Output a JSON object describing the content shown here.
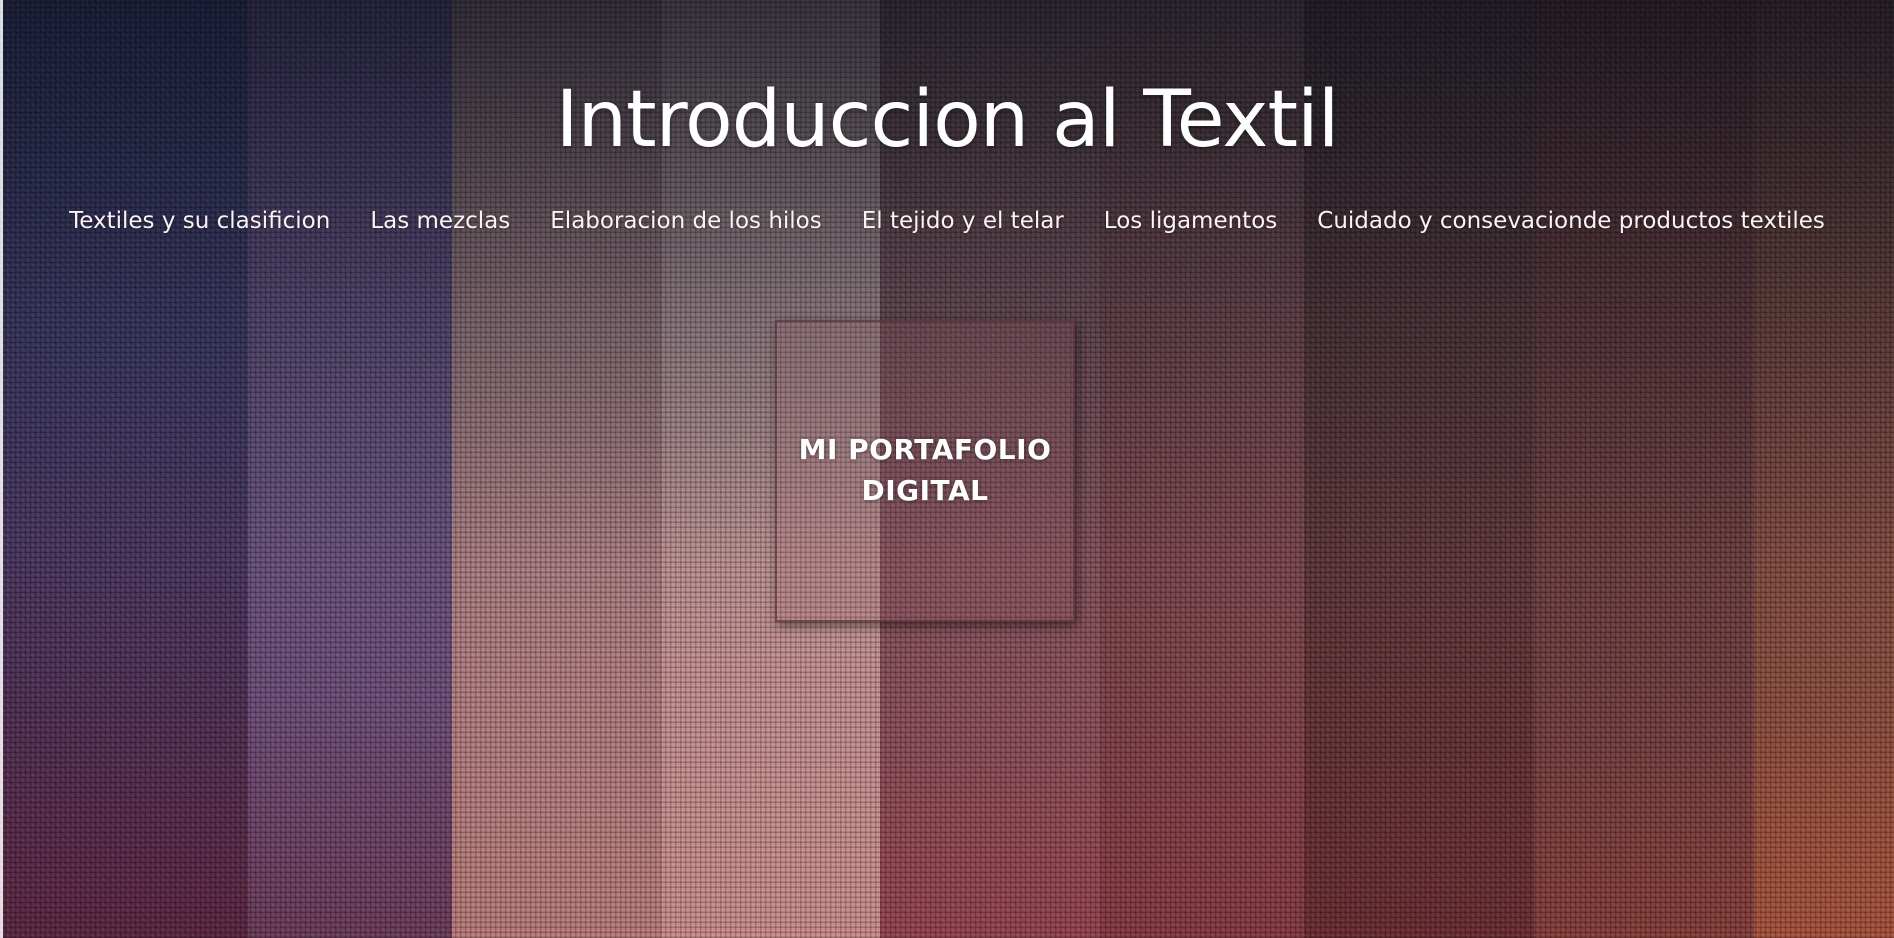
{
  "header": {
    "title": "Introduccion al Textil"
  },
  "nav": {
    "items": [
      {
        "label": "Textiles y su clasificion"
      },
      {
        "label": "Las mezclas"
      },
      {
        "label": "Elaboracion de los hilos"
      },
      {
        "label": "El tejido y el telar"
      },
      {
        "label": "Los ligamentos"
      },
      {
        "label": "Cuidado y consevacionde productos textiles"
      }
    ]
  },
  "hero": {
    "button_label": "MI PORTAFOLIO DIGITAL"
  },
  "background": {
    "image": "woven-fabric-stripes",
    "colors": [
      "#2a2e52",
      "#4c3e66",
      "#8a6a72",
      "#b58686",
      "#6e4150",
      "#5a2e34",
      "#6a3a3c",
      "#3a2226",
      "#6e3628"
    ]
  }
}
